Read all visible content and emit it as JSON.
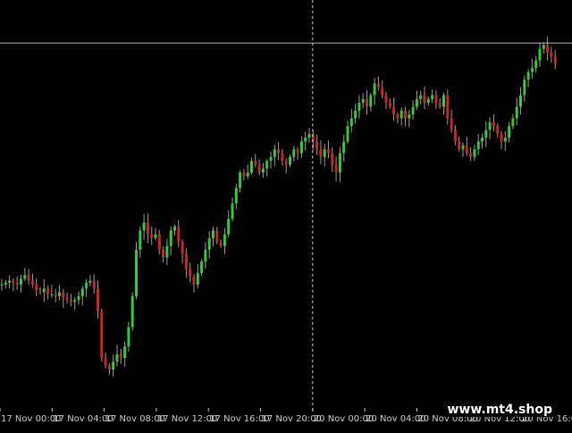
{
  "watermark": "www.mt4.shop",
  "colors": {
    "background": "#000000",
    "bull": "#2ecc2e",
    "bear": "#cc2222",
    "wick": "#9a9a9a",
    "axis_text": "#c8c8c8",
    "crosshair": "#d0d0d0"
  },
  "chart_data": {
    "type": "candlestick",
    "title": "",
    "xlabel": "",
    "ylabel": "",
    "grid": false,
    "ylim": [
      0,
      1
    ],
    "x_tick_labels": [
      "17 Nov 00:00",
      "17 Nov 04:00",
      "17 Nov 08:00",
      "17 Nov 12:00",
      "17 Nov 16:00",
      "17 Nov 20:00",
      "20 Nov 00:00",
      "20 Nov 04:00",
      "20 Nov 08:00",
      "20 Nov 12:00",
      "20 Nov 16:00",
      "20 N"
    ],
    "crosshair_tick_index": 6,
    "horizontal_level": 0.935,
    "close_series": [
      0.31,
      0.315,
      0.32,
      0.315,
      0.31,
      0.325,
      0.335,
      0.32,
      0.31,
      0.295,
      0.29,
      0.3,
      0.285,
      0.285,
      0.28,
      0.29,
      0.275,
      0.27,
      0.265,
      0.27,
      0.28,
      0.3,
      0.315,
      0.32,
      0.3,
      0.24,
      0.12,
      0.1,
      0.09,
      0.11,
      0.13,
      0.12,
      0.15,
      0.2,
      0.28,
      0.4,
      0.45,
      0.47,
      0.44,
      0.43,
      0.44,
      0.4,
      0.38,
      0.41,
      0.45,
      0.46,
      0.42,
      0.39,
      0.35,
      0.33,
      0.31,
      0.34,
      0.37,
      0.4,
      0.43,
      0.45,
      0.42,
      0.41,
      0.44,
      0.48,
      0.52,
      0.56,
      0.6,
      0.59,
      0.6,
      0.63,
      0.62,
      0.6,
      0.61,
      0.63,
      0.64,
      0.66,
      0.65,
      0.63,
      0.62,
      0.64,
      0.66,
      0.65,
      0.68,
      0.69,
      0.7,
      0.68,
      0.66,
      0.64,
      0.66,
      0.65,
      0.62,
      0.6,
      0.65,
      0.68,
      0.72,
      0.74,
      0.76,
      0.78,
      0.79,
      0.77,
      0.8,
      0.83,
      0.82,
      0.8,
      0.78,
      0.77,
      0.75,
      0.74,
      0.76,
      0.74,
      0.75,
      0.77,
      0.79,
      0.8,
      0.78,
      0.79,
      0.8,
      0.78,
      0.77,
      0.8,
      0.74,
      0.71,
      0.68,
      0.66,
      0.67,
      0.65,
      0.64,
      0.66,
      0.68,
      0.69,
      0.71,
      0.73,
      0.72,
      0.7,
      0.68,
      0.69,
      0.72,
      0.74,
      0.77,
      0.8,
      0.84,
      0.86,
      0.87,
      0.89,
      0.92,
      0.93,
      0.91,
      0.9,
      0.88
    ]
  }
}
